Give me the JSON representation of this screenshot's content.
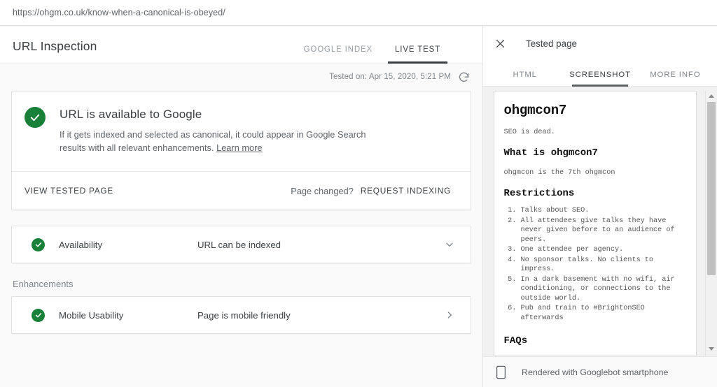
{
  "browser": {
    "url": "https://ohgm.co.uk/know-when-a-canonical-is-obeyed/"
  },
  "main": {
    "title": "URL Inspection",
    "tabs": [
      {
        "label": "GOOGLE INDEX",
        "active": false
      },
      {
        "label": "LIVE TEST",
        "active": true
      }
    ],
    "tested_on": "Tested on: Apr 15, 2020, 5:21 PM",
    "refresh_icon": "refresh-icon",
    "status_card": {
      "icon": "check-circle-icon",
      "title": "URL is available to Google",
      "description": "If it gets indexed and selected as canonical, it could appear in Google Search results with all relevant enhancements.",
      "learn_more": "Learn more",
      "view_tested_page": "VIEW TESTED PAGE",
      "page_changed": "Page changed?",
      "request_indexing": "REQUEST INDEXING"
    },
    "results": [
      {
        "icon": "check-circle-icon",
        "label": "Availability",
        "value": "URL can be indexed",
        "chevron": "chevron-down-icon"
      }
    ],
    "enhancements_label": "Enhancements",
    "enhancements": [
      {
        "icon": "check-circle-icon",
        "label": "Mobile Usability",
        "value": "Page is mobile friendly",
        "chevron": "chevron-right-icon"
      }
    ]
  },
  "details": {
    "close_icon": "close-icon",
    "title": "Tested page",
    "tabs": [
      {
        "label": "HTML",
        "active": false
      },
      {
        "label": "SCREENSHOT",
        "active": true
      },
      {
        "label": "MORE INFO",
        "active": false
      }
    ],
    "screenshot": {
      "heading": "ohgmcon7",
      "tagline": "SEO is dead.",
      "section1_heading": "What is ohgmcon7",
      "section1_text": "ohgmcon is the 7th ohgmcon",
      "section2_heading": "Restrictions",
      "restrictions": [
        "Talks about SEO.",
        "All attendees give talks they have never given before to an audience of peers.",
        "One attendee per agency.",
        "No sponsor talks. No clients to impress.",
        "In a dark basement with no wifi, air conditioning, or connections to the outside world.",
        "Pub and train to #BrightonSEO afterwards"
      ],
      "section3_heading": "FAQs"
    },
    "footer": {
      "icon": "smartphone-icon",
      "text": "Rendered with Googlebot smartphone"
    }
  },
  "colors": {
    "success_green": "#188038",
    "text_primary": "#3c4043",
    "text_secondary": "#5f6368"
  }
}
